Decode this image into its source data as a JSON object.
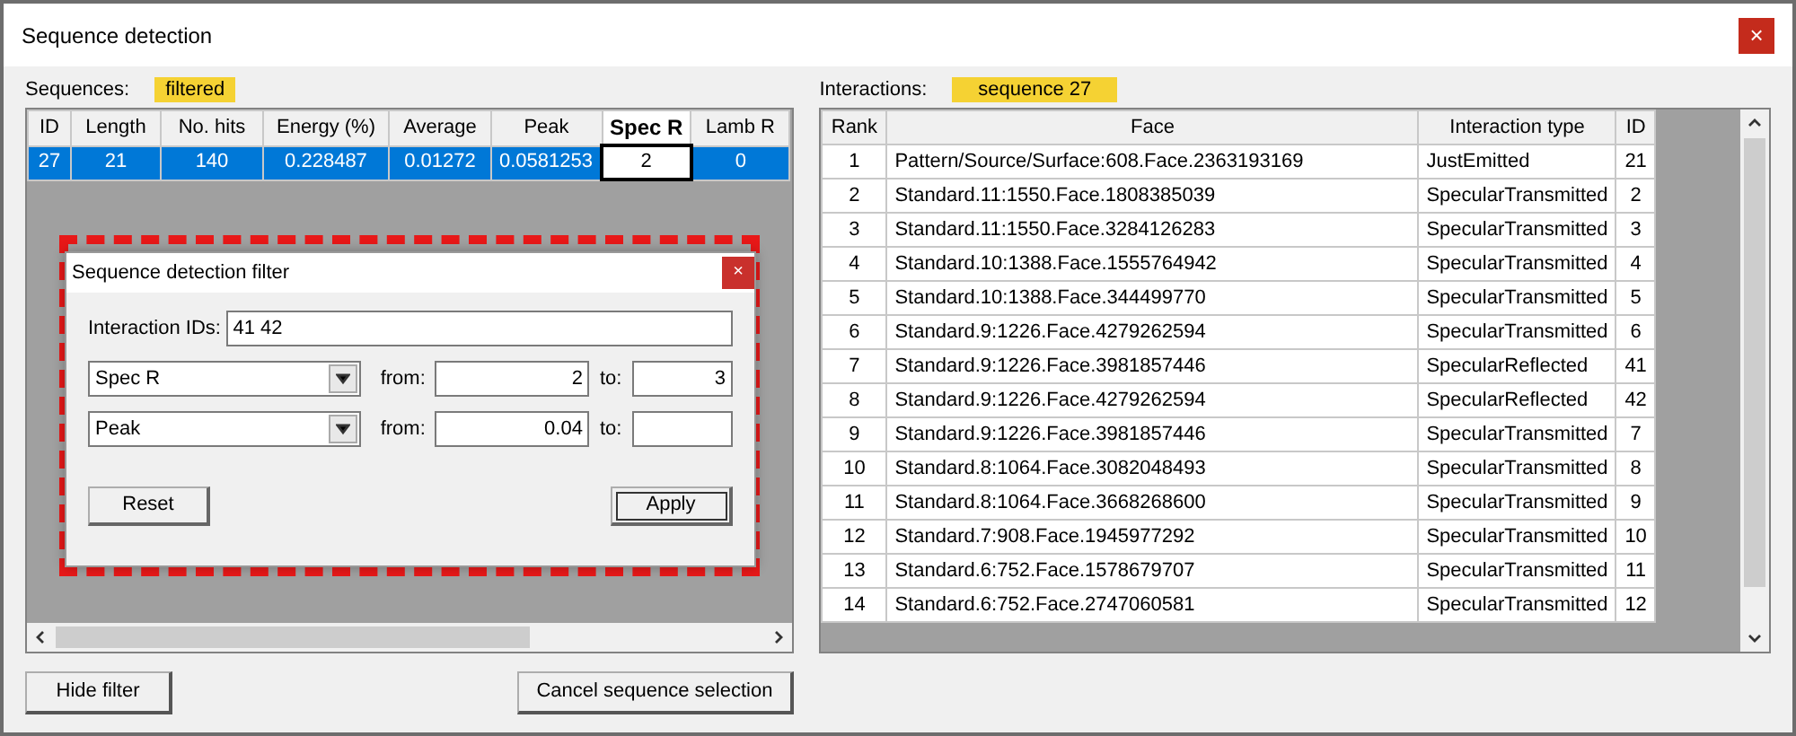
{
  "window": {
    "title": "Sequence detection"
  },
  "sequences": {
    "label": "Sequences:",
    "badge": "filtered",
    "columns": [
      {
        "label": "ID",
        "current": false
      },
      {
        "label": "Length",
        "current": false
      },
      {
        "label": "No. hits",
        "current": false
      },
      {
        "label": "Energy (%)",
        "current": false
      },
      {
        "label": "Average",
        "current": false
      },
      {
        "label": "Peak",
        "current": false
      },
      {
        "label": "Spec R",
        "current": true
      },
      {
        "label": "Lamb R",
        "current": false
      }
    ],
    "rows": [
      {
        "selected": true,
        "cells": [
          "27",
          "21",
          "140",
          "0.228487",
          "0.01272",
          "0.0581253",
          "2",
          "0"
        ]
      }
    ]
  },
  "filter_dialog": {
    "title": "Sequence detection filter",
    "close": "×",
    "ids_label": "Interaction IDs:",
    "ids_value": "41 42",
    "conditions": [
      {
        "field": "Spec R",
        "from_label": "from:",
        "from": "2",
        "to_label": "to:",
        "to": "3"
      },
      {
        "field": "Peak",
        "from_label": "from:",
        "from": "0.04",
        "to_label": "to:"
      }
    ],
    "buttons": [
      {
        "label": "Reset",
        "default": false
      },
      {
        "label": "Apply",
        "default": true
      }
    ]
  },
  "interactions": {
    "label": "Interactions:",
    "badge": "sequence 27",
    "columns": [
      "Rank",
      "Face",
      "Interaction type",
      "ID"
    ],
    "rows": [
      [
        "1",
        "Pattern/Source/Surface:608.Face.2363193169",
        "JustEmitted",
        "21"
      ],
      [
        "2",
        "Standard.11:1550.Face.1808385039",
        "SpecularTransmitted",
        "2"
      ],
      [
        "3",
        "Standard.11:1550.Face.3284126283",
        "SpecularTransmitted",
        "3"
      ],
      [
        "4",
        "Standard.10:1388.Face.1555764942",
        "SpecularTransmitted",
        "4"
      ],
      [
        "5",
        "Standard.10:1388.Face.344499770",
        "SpecularTransmitted",
        "5"
      ],
      [
        "6",
        "Standard.9:1226.Face.4279262594",
        "SpecularTransmitted",
        "6"
      ],
      [
        "7",
        "Standard.9:1226.Face.3981857446",
        "SpecularReflected",
        "41"
      ],
      [
        "8",
        "Standard.9:1226.Face.4279262594",
        "SpecularReflected",
        "42"
      ],
      [
        "9",
        "Standard.9:1226.Face.3981857446",
        "SpecularTransmitted",
        "7"
      ],
      [
        "10",
        "Standard.8:1064.Face.3082048493",
        "SpecularTransmitted",
        "8"
      ],
      [
        "11",
        "Standard.8:1064.Face.3668268600",
        "SpecularTransmitted",
        "9"
      ],
      [
        "12",
        "Standard.7:908.Face.1945977292",
        "SpecularTransmitted",
        "10"
      ],
      [
        "13",
        "Standard.6:752.Face.1578679707",
        "SpecularTransmitted",
        "11"
      ],
      [
        "14",
        "Standard.6:752.Face.2747060581",
        "SpecularTransmitted",
        "12"
      ]
    ]
  },
  "buttons": [
    {
      "label": "Hide filter"
    },
    {
      "label": "Cancel sequence selection"
    }
  ]
}
